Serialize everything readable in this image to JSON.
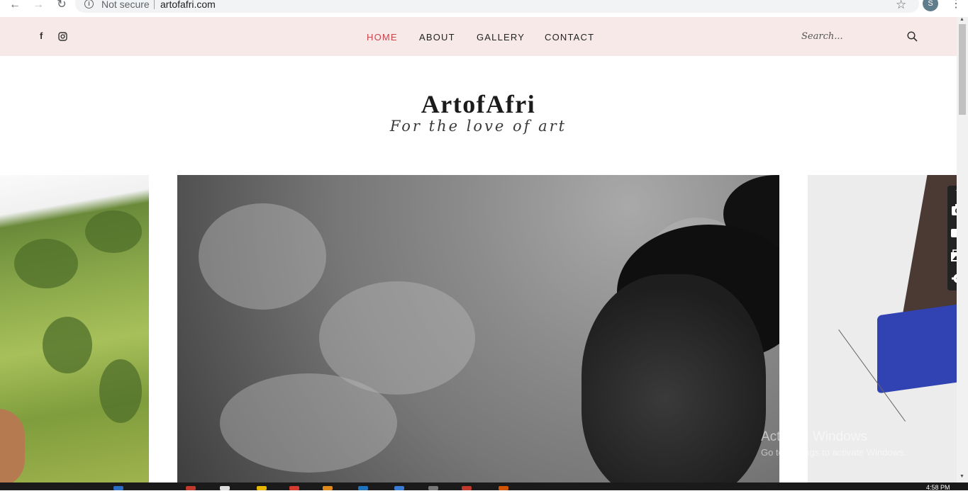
{
  "browser": {
    "security_label": "Not secure",
    "url": "artofafri.com",
    "profile_initial": "S"
  },
  "nav": {
    "items": [
      "HOME",
      "ABOUT",
      "GALLERY",
      "CONTACT"
    ],
    "active_index": 0,
    "active_color": "#c8444b"
  },
  "search": {
    "placeholder": "Search..."
  },
  "logo": {
    "title": "ArtofAfri",
    "tagline": "For the love of art"
  },
  "watermark": {
    "line1": "Activate Windows",
    "line2": "Go to Settings to activate Windows."
  },
  "taskbar": {
    "clock": "4:58 PM"
  },
  "colors": {
    "topbar_bg": "#f8e9e9",
    "accent": "#c8444b"
  }
}
